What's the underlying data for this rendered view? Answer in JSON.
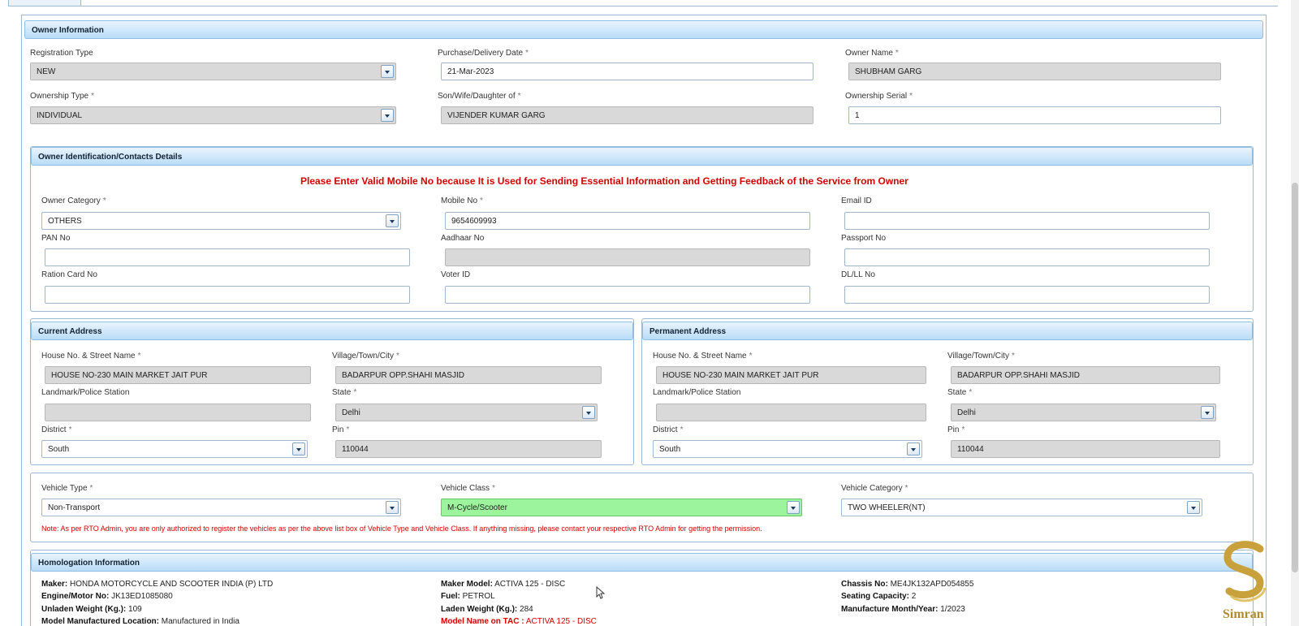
{
  "owner_info": {
    "title": "Owner Information",
    "registration_type": {
      "label": "Registration Type",
      "value": "NEW"
    },
    "purchase_date": {
      "label": "Purchase/Delivery Date",
      "value": "21-Mar-2023"
    },
    "owner_name": {
      "label": "Owner Name",
      "value": "SHUBHAM GARG"
    },
    "ownership_type": {
      "label": "Ownership Type",
      "value": "INDIVIDUAL"
    },
    "son_wife_daughter_of": {
      "label": "Son/Wife/Daughter of",
      "value": "VIJENDER KUMAR GARG"
    },
    "ownership_serial": {
      "label": "Ownership Serial",
      "value": "1"
    },
    "required_mark": "*"
  },
  "identification": {
    "title": "Owner Identification/Contacts Details",
    "warning": "Please Enter Valid Mobile No because It is Used for Sending Essential Information and Getting Feedback of the Service from Owner",
    "owner_category": {
      "label": "Owner Category",
      "value": "OTHERS"
    },
    "mobile_no": {
      "label": "Mobile No",
      "value": "9654609993"
    },
    "email_id": {
      "label": "Email ID",
      "value": ""
    },
    "pan_no": {
      "label": "PAN No",
      "value": ""
    },
    "aadhaar_no": {
      "label": "Aadhaar No",
      "value": ""
    },
    "passport_no": {
      "label": "Passport No",
      "value": ""
    },
    "ration_card_no": {
      "label": "Ration Card No",
      "value": ""
    },
    "voter_id": {
      "label": "Voter ID",
      "value": ""
    },
    "dl_ll_no": {
      "label": "DL/LL No",
      "value": ""
    }
  },
  "current_address": {
    "title": "Current Address",
    "house": {
      "label": "House No. & Street Name",
      "value": "HOUSE NO-230 MAIN MARKET JAIT PUR"
    },
    "village": {
      "label": "Village/Town/City",
      "value": "BADARPUR OPP.SHAHI MASJID"
    },
    "landmark": {
      "label": "Landmark/Police Station",
      "value": ""
    },
    "state": {
      "label": "State",
      "value": "Delhi"
    },
    "district": {
      "label": "District",
      "value": "South"
    },
    "pin": {
      "label": "Pin",
      "value": "110044"
    }
  },
  "permanent_address": {
    "title": "Permanent Address",
    "house": {
      "label": "House No. & Street Name",
      "value": "HOUSE NO-230 MAIN MARKET JAIT PUR"
    },
    "village": {
      "label": "Village/Town/City",
      "value": "BADARPUR OPP.SHAHI MASJID"
    },
    "landmark": {
      "label": "Landmark/Police Station",
      "value": ""
    },
    "state": {
      "label": "State",
      "value": "Delhi"
    },
    "district": {
      "label": "District",
      "value": "South"
    },
    "pin": {
      "label": "Pin",
      "value": "110044"
    }
  },
  "vehicle": {
    "vehicle_type": {
      "label": "Vehicle Type",
      "value": "Non-Transport"
    },
    "vehicle_class": {
      "label": "Vehicle Class",
      "value": "M-Cycle/Scooter"
    },
    "vehicle_category": {
      "label": "Vehicle Category",
      "value": "TWO WHEELER(NT)"
    },
    "note": "Note: As per RTO Admin, you are only authorized to register the vehicles as per the above list box of Vehicle Type and Vehicle Class. If anything missing, please contact your respective RTO Admin for getting the permission."
  },
  "homologation": {
    "title": "Homologation Information",
    "maker": {
      "label": "Maker:",
      "value": "HONDA MOTORCYCLE AND SCOOTER INDIA (P) LTD"
    },
    "engine_no": {
      "label": "Engine/Motor No:",
      "value": "JK13ED1085080"
    },
    "unladen_weight": {
      "label": "Unladen Weight (Kg.):",
      "value": "109"
    },
    "manufactured_location": {
      "label": "Model Manufactured Location:",
      "value": "Manufactured in India"
    },
    "maker_model": {
      "label": "Maker Model:",
      "value": "ACTIVA 125 - DISC"
    },
    "fuel": {
      "label": "Fuel:",
      "value": "PETROL"
    },
    "laden_weight": {
      "label": "Laden Weight (Kg.):",
      "value": "284"
    },
    "model_name_tac": {
      "label": "Model Name on TAC :",
      "value": "ACTIVA 125 - DISC"
    },
    "chassis_no": {
      "label": "Chassis No:",
      "value": "ME4JK132APD054855"
    },
    "seating_capacity": {
      "label": "Seating Capacity:",
      "value": "2"
    },
    "manufacture_month_year": {
      "label": "Manufacture Month/Year:",
      "value": "1/2023"
    }
  },
  "watermark": {
    "text": "Simran"
  },
  "colors": {
    "accent": "#b9dcf6",
    "warning": "#d40000",
    "highlight": "#9cf59c",
    "readonly": "#d9d9d9"
  }
}
